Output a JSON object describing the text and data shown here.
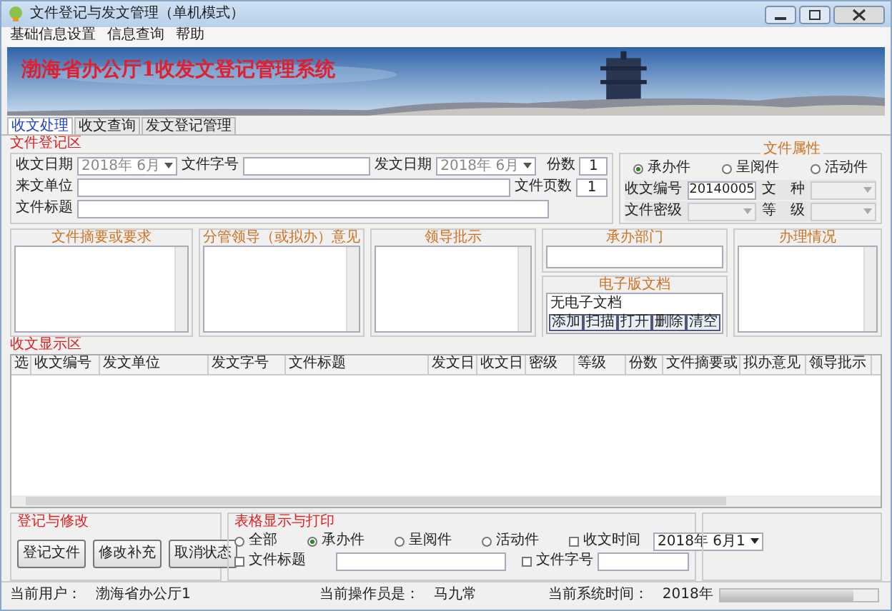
{
  "window": {
    "title": "文件登记与发文管理（单机模式）"
  },
  "menu": [
    "基础信息设置",
    "信息查询",
    "帮助"
  ],
  "banner": {
    "title": "渤海省办公厅1收发文登记管理系统"
  },
  "tabs": [
    {
      "label": "收文处理",
      "selected": true
    },
    {
      "label": "收文查询",
      "selected": false
    },
    {
      "label": "发文登记管理",
      "selected": false
    }
  ],
  "registration": {
    "title": "文件登记区",
    "receive_date": {
      "label": "收文日期",
      "value": "2018年 6月"
    },
    "doc_number": {
      "label": "文件字号"
    },
    "send_date": {
      "label": "发文日期",
      "value": "2018年 6月"
    },
    "copies": {
      "label": "份数",
      "value": "1"
    },
    "pages": {
      "label": "文件页数",
      "value": "1"
    },
    "sender": {
      "label": "来文单位"
    },
    "doc_title": {
      "label": "文件标题"
    }
  },
  "attributes": {
    "title": "文件属性",
    "types": [
      {
        "label": "承办件",
        "selected": true
      },
      {
        "label": "呈阅件",
        "selected": false
      },
      {
        "label": "活动件",
        "selected": false
      }
    ],
    "serial": {
      "label": "收文编号",
      "value": "20140005"
    },
    "secrecy": {
      "label": "文件密级"
    },
    "category": {
      "label": "文　种"
    },
    "grade": {
      "label": "等　级"
    }
  },
  "panels": {
    "summary": "文件摘要或要求",
    "opinion": "分管领导（或拟办）意见",
    "instruction": "领导批示",
    "department": "承办部门",
    "handling": "办理情况",
    "electronic": {
      "title": "电子版文档",
      "content": "无电子文档",
      "buttons": [
        "添加",
        "扫描",
        "打开",
        "删除",
        "清空"
      ]
    }
  },
  "table": {
    "title": "收文显示区",
    "columns": [
      "选",
      "收文编号",
      "发文单位",
      "发文字号",
      "文件标题",
      "发文日",
      "收文日",
      "密级",
      "等级",
      "份数",
      "文件摘要或",
      "拟办意见",
      "领导批示"
    ]
  },
  "edit_group": {
    "title": "登记与修改",
    "buttons": [
      "登记文件",
      "修改补充",
      "取消状态"
    ]
  },
  "print_group": {
    "title": "表格显示与打印",
    "radios": [
      {
        "label": "全部",
        "selected": false
      },
      {
        "label": "承办件",
        "selected": true
      },
      {
        "label": "呈阅件",
        "selected": false
      },
      {
        "label": "活动件",
        "selected": false
      }
    ],
    "checks": [
      {
        "label": "收文时间",
        "checked": false
      },
      {
        "label": "文件标题",
        "checked": false
      },
      {
        "label": "文件字号",
        "checked": false
      }
    ],
    "date": "2018年 6月1"
  },
  "status_bar": [
    {
      "label": "当前用户：",
      "value": "渤海省办公厅1"
    },
    {
      "label": "当前操作员是：",
      "value": "马九常"
    },
    {
      "label": "当前系统时间：",
      "value": "2018年"
    }
  ],
  "status_progress": {
    "level": 0.85
  }
}
